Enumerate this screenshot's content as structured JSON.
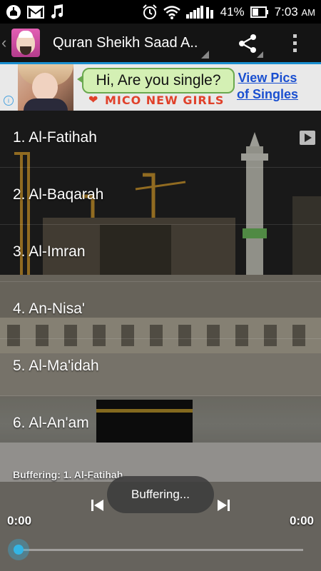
{
  "status_bar": {
    "battery_percent": "41%",
    "time": "7:03",
    "ampm": "AM",
    "icons_left": [
      "mosque-notification-icon",
      "gmail-icon",
      "music-note-icon"
    ],
    "icons_right": [
      "alarm-icon",
      "wifi-icon",
      "signal-icon",
      "battery-icon"
    ]
  },
  "action_bar": {
    "title": "Quran Sheikh Saad A..",
    "accent": "#1a8fd0"
  },
  "ad": {
    "bubble_text": "Hi, Are you single?",
    "brand_text": "MICO NEW GIRLS",
    "link_text_1": "View Pics",
    "link_text_2": "of Singles",
    "info_glyph": "i"
  },
  "surahs": [
    {
      "label": "1. Al-Fatihah"
    },
    {
      "label": "2. Al-Baqarah"
    },
    {
      "label": "3. Al-Imran"
    },
    {
      "label": "4. An-Nisa'"
    },
    {
      "label": "5. Al-Ma'idah"
    },
    {
      "label": "6. Al-An'am"
    }
  ],
  "player": {
    "buffer_status": "Buffering: 1. Al-Fatihah",
    "toast": "Buffering...",
    "time_elapsed": "0:00",
    "time_total": "0:00",
    "progress": 0,
    "accent": "#33b5e5"
  }
}
